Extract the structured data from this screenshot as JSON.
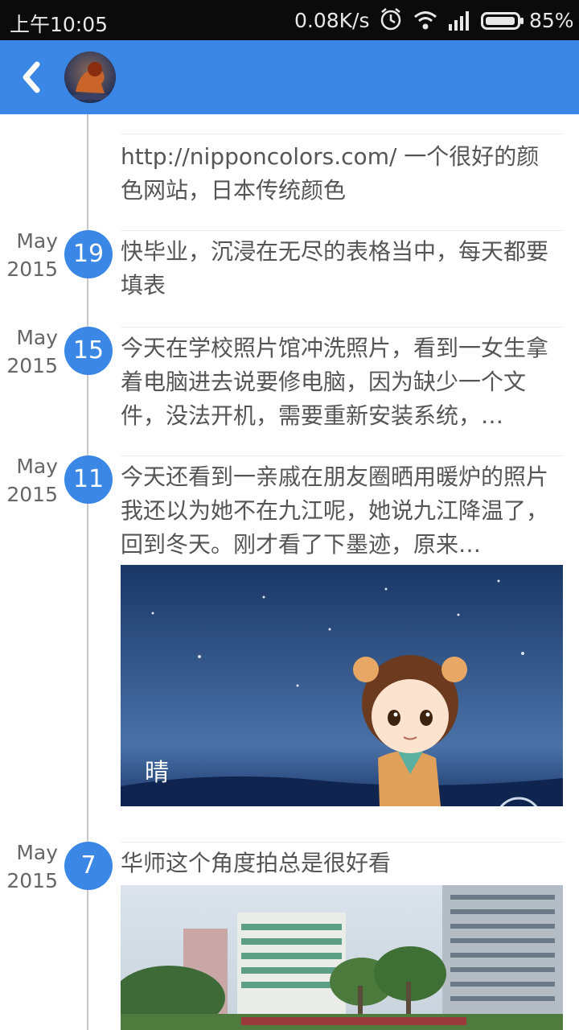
{
  "status_bar": {
    "time": "上午10:05",
    "network_speed": "0.08K/s",
    "battery": "85%",
    "icons": [
      "alarm-icon",
      "wifi-icon",
      "signal-icon",
      "battery-icon"
    ]
  },
  "app_bar": {
    "back_icon": "back-chevron-icon",
    "avatar": "lion-avatar",
    "color": "#3b87e6"
  },
  "timeline": [
    {
      "text": "http://nipponcolors.com/ 一个很好的颜色网站，日本传统颜色"
    },
    {
      "month": "May",
      "year": "2015",
      "day": "19",
      "text": "快毕业，沉浸在无尽的表格当中，每天都要填表"
    },
    {
      "month": "May",
      "year": "2015",
      "day": "15",
      "text": "今天在学校照片馆冲洗照片，看到一女生拿着电脑进去说要修电脑，因为缺少一个文件，没法开机，需要重新安装系统，…"
    },
    {
      "month": "May",
      "year": "2015",
      "day": "11",
      "text": "今天还看到一亲戚在朋友圈晒用暖炉的照片我还以为她不在九江呢，她说九江降温了，回到冬天。刚才看了下墨迹，原来…",
      "image_caption": "晴"
    },
    {
      "month": "May",
      "year": "2015",
      "day": "7",
      "text": "华师这个角度拍总是很好看"
    }
  ]
}
